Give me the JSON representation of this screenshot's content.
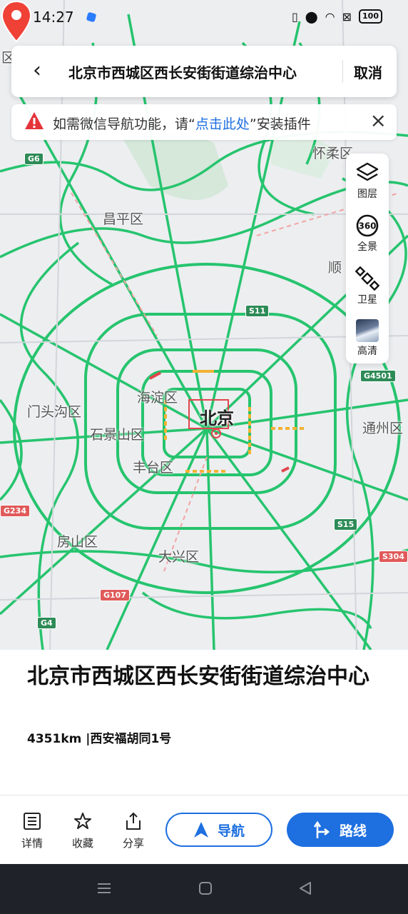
{
  "status_bar": {
    "time": "14:27",
    "battery": "100"
  },
  "search": {
    "title": "北京市西城区西长安街街道综治中心",
    "cancel_label": "取消"
  },
  "notice": {
    "prefix": "如需微信导航功能，请“",
    "link": "点击此处",
    "suffix": "”安装插件"
  },
  "tools": [
    {
      "label": "图层",
      "icon": "layers-icon"
    },
    {
      "label": "全景",
      "icon": "panorama-360-icon"
    },
    {
      "label": "卫星",
      "icon": "satellite-icon"
    },
    {
      "label": "高清",
      "icon": "hd-thumbnail-icon"
    }
  ],
  "map": {
    "city_label": "北京",
    "districts": [
      "怀柔区",
      "昌平区",
      "顺",
      "海淀区",
      "门头沟区",
      "石景山区",
      "丰台区",
      "通州区",
      "房山区",
      "大兴区",
      "区"
    ],
    "road_shields": [
      "G6",
      "S11",
      "G4501",
      "G234",
      "S15",
      "S304",
      "G107",
      "G4"
    ],
    "colors": {
      "road": "#26c46e",
      "congestion": "#f2b233",
      "jam": "#e0464b",
      "pin": "#ef4136"
    }
  },
  "place": {
    "name": "北京市西城区西长安街街道综治中心",
    "distance": "4351km",
    "address": "|西安福胡同1号"
  },
  "actions": {
    "details": "详情",
    "favorite": "收藏",
    "share": "分享",
    "navigate": "导航",
    "route": "路线"
  },
  "accent_color": "#1e6fe0"
}
